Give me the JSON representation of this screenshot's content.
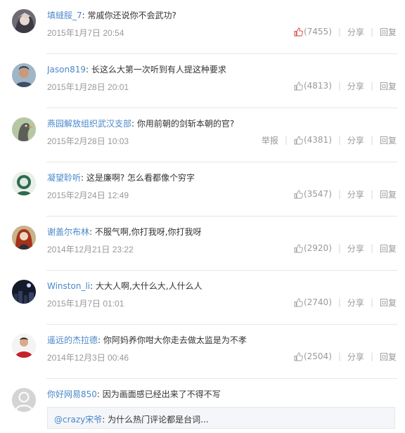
{
  "comments": [
    {
      "username": "填縫脮_7",
      "text": "常戚你还说你不会武功?",
      "time": "2015年1月7日 20:54",
      "likes": "(7455)",
      "liked": true,
      "report": "",
      "share": "分享",
      "reply": "回复",
      "avatar_icon": "anime-avatar-icon"
    },
    {
      "username": "Jason819",
      "text": "长这么大第一次听到有人提这种要求",
      "time": "2015年1月28日 20:01",
      "likes": "(4813)",
      "liked": false,
      "report": "",
      "share": "分享",
      "reply": "回复",
      "avatar_icon": "person-avatar-icon"
    },
    {
      "username": "燕园解放组织武汉支部",
      "text": "你用前朝的剑斩本朝的官?",
      "time": "2015年2月28日 10:03",
      "likes": "(4381)",
      "liked": false,
      "report": "举报",
      "share": "分享",
      "reply": "回复",
      "avatar_icon": "bird-avatar-icon"
    },
    {
      "username": "凝望聆听",
      "text": "这是廉啊? 怎么看都像个穷字",
      "time": "2015年2月24日 12:49",
      "likes": "(3547)",
      "liked": false,
      "report": "",
      "share": "分享",
      "reply": "回复",
      "avatar_icon": "green-figure-avatar-icon"
    },
    {
      "username": "谢盖尔布林",
      "text": "不服气啊,你打我呀,你打我呀",
      "time": "2014年12月21日 23:22",
      "likes": "(2920)",
      "liked": false,
      "report": "",
      "share": "分享",
      "reply": "回复",
      "avatar_icon": "red-hair-avatar-icon"
    },
    {
      "username": "Winston_li",
      "text": "大大人啊,大什么大,人什么人",
      "time": "2015年1月7日 01:01",
      "likes": "(2740)",
      "liked": false,
      "report": "",
      "share": "分享",
      "reply": "回复",
      "avatar_icon": "night-city-avatar-icon"
    },
    {
      "username": "遥远的杰拉德",
      "text": "你阿妈养你咁大你走去做太监是为不孝",
      "time": "2014年12月3日 00:46",
      "likes": "(2504)",
      "liked": false,
      "report": "",
      "share": "分享",
      "reply": "回复",
      "avatar_icon": "red-shirt-avatar-icon"
    },
    {
      "username": "你好网易850",
      "text": "因为画面感已经出来了不得不写",
      "time": "",
      "likes": "",
      "liked": false,
      "report": "",
      "share": "",
      "reply": "",
      "avatar_icon": "default-user-avatar-icon"
    }
  ],
  "reply_preview": {
    "username": "@crazy宋爷",
    "text": "为什么热门评论都是台词..."
  },
  "colors": {
    "username": "#4a87c8",
    "liked": "#d9534f",
    "meta": "#999999",
    "divider": "#e6e6e6"
  }
}
